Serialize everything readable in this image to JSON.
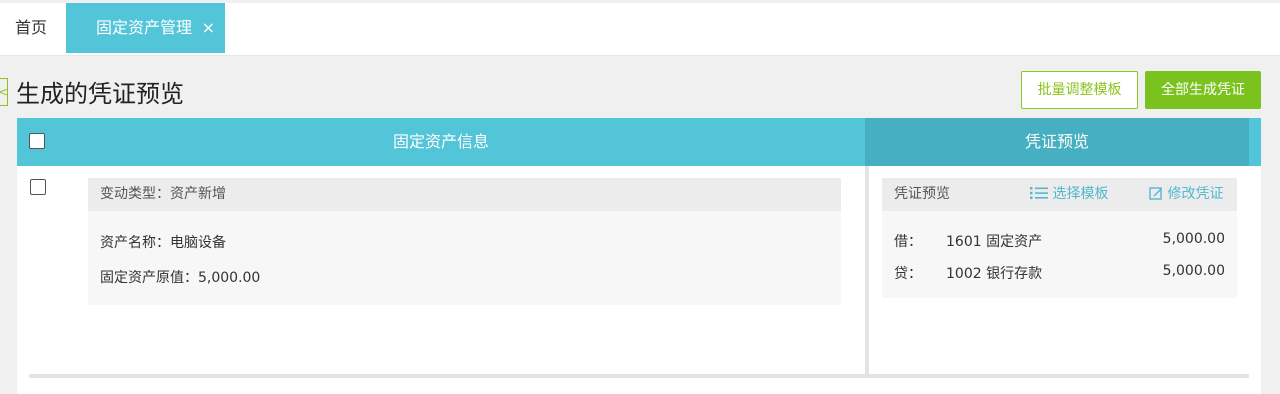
{
  "tabs": {
    "home": "首页",
    "active": "固定资产管理",
    "close_glyph": "×"
  },
  "header": {
    "back_glyph": "<",
    "title": "生成的凭证预览",
    "batch_button": "批量调整模板",
    "generate_button": "全部生成凭证"
  },
  "table": {
    "left_header": "固定资产信息",
    "right_header": "凭证预览"
  },
  "asset": {
    "change_type": "变动类型：资产新增",
    "name": "资产名称：电脑设备",
    "original_value": "固定资产原值：5,000.00"
  },
  "voucher": {
    "title": "凭证预览",
    "select_template": "选择模板",
    "edit_voucher": "修改凭证",
    "entries": [
      {
        "dir": "借：",
        "account": "1601 固定资产",
        "amount": "5,000.00"
      },
      {
        "dir": "贷：",
        "account": "1002 银行存款",
        "amount": "5,000.00"
      }
    ]
  },
  "colors": {
    "accent": "#52c5d9",
    "accent_dark": "#46b0c2",
    "green": "#7ac31f",
    "link": "#52b8d0"
  }
}
